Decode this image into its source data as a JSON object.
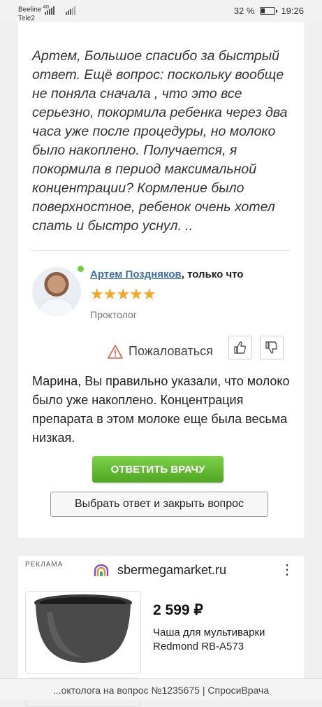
{
  "status_bar": {
    "carrier_1": "Beeline",
    "carrier_1_network": "4G",
    "carrier_2": "Tele2",
    "battery_percent": "32 %",
    "battery_level": 0.32,
    "time": "19:26"
  },
  "question": {
    "text": "Артем, Большое спасибо за быстрый ответ. Ещё вопрос: поскольку вообще не поняла сначала , что это все серьезно, покормила ребенка через два часа уже после процедуры, но молоко было накоплено. Получается, я покормила в период максимальной концентрации? Кормление было поверхностное, ребенок очень хотел спать и быстро уснул. .."
  },
  "doctor": {
    "name": "Артем Поздняков",
    "time_suffix": ", только что",
    "rating_stars": 5,
    "stars_display": "★★★★★",
    "role": "Проктолог",
    "online": true,
    "online_color": "#6fcf3f"
  },
  "actions": {
    "complain_label": "Пожаловаться"
  },
  "answer": {
    "text": "Марина, Вы правильно указали, что молоко было уже накоплено. Концентрация препарата в этом молоке еще была весьма низкая."
  },
  "buttons": {
    "reply_doctor": "ОТВЕТИТЬ ВРАЧУ",
    "choose_answer": "Выбрать ответ и закрыть вопрос"
  },
  "ad": {
    "label": "РЕКЛАМА",
    "domain": "sbermegamarket.ru",
    "price": "2 599 ₽",
    "title": "Чаша для мультиварки Redmond RB-A573"
  },
  "bottom_bar": {
    "title": "...октолога на вопрос №1235675 | СпросиВрача"
  },
  "colors": {
    "accent_green": "#5cb82e",
    "link_blue": "#3a6fb0",
    "star": "#f5a623"
  }
}
